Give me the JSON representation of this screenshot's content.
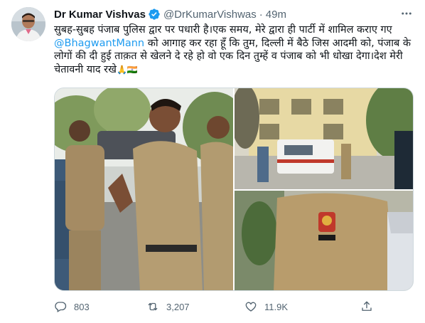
{
  "tweet": {
    "author_name": "Dr Kumar Vishvas",
    "handle": "@DrKumarVishwas",
    "separator": "·",
    "time": "49m",
    "text_part1": "सुबह-सुबह पंजाब पुलिस द्वार पर पधारी है।एक समय, मेरे द्वारा ही पार्टी में शामिल कराए गए ",
    "mention": "@BhagwantMann",
    "text_part2": " को आगाह कर रहा हूँ कि तुम, दिल्ली में बैठे जिस आदमी को, पंजाब के लोगों की दी हुई ताक़त से खेलने दे रहे हो वो एक दिन तुम्हें व पंजाब को भी धोखा देगा।देश मेरी चेतावनी याद रखे",
    "emojis": "🙏🇮🇳",
    "more_icon": "ellipsis-icon"
  },
  "actions": {
    "reply_count": "803",
    "retweet_count": "3,207",
    "like_count": "11.9K"
  },
  "colors": {
    "link": "#1d9bf0",
    "muted": "#536471",
    "verified": "#1d9bf0"
  }
}
